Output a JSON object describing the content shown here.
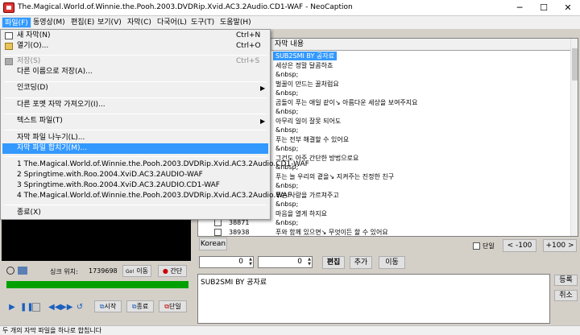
{
  "window": {
    "title": "The.Magical.World.of.Winnie.the.Pooh.2003.DVDRip.Xvid.AC3.2Audio.CD1-WAF - NeoCaption"
  },
  "menubar": [
    "파일(F)",
    "동영상(M)",
    "편집(E)",
    "보기(V)",
    "자막(C)",
    "다국어(L)",
    "도구(T)",
    "도움말(H)"
  ],
  "file_menu": {
    "new": {
      "label": "새 자막(N)",
      "shortcut": "Ctrl+N"
    },
    "open": {
      "label": "열기(O)...",
      "shortcut": "Ctrl+O"
    },
    "save": {
      "label": "저장(S)",
      "shortcut": "Ctrl+S"
    },
    "save_as": {
      "label": "다른 이름으로 저장(A)..."
    },
    "encoding": {
      "label": "인코딩(D)"
    },
    "import": {
      "label": "다른 포멧 자막 가져오기(I)..."
    },
    "text_file": {
      "label": "텍스트 파일(T)"
    },
    "split": {
      "label": "자막 파일 나누기(L)..."
    },
    "merge": {
      "label": "자막 파일 합치기(M)..."
    },
    "recent": [
      "1 The.Magical.World.of.Winnie.the.Pooh.2003.DVDRip.Xvid.AC3.2Audio.CD1-WAF",
      "2 Springtime.with.Roo.2004.XviD.AC3.2AUDIO-WAF",
      "3 Springtime.with.Roo.2004.XviD.AC3.2AUDIO.CD1-WAF",
      "4 The.Magical.World.of.Winnie.the.Pooh.2003.DVDRip.Xvid.AC3.2Audio.WAF"
    ],
    "exit": {
      "label": "종료(X)"
    }
  },
  "list": {
    "header_text": "자막 내용",
    "rows": [
      {
        "time": "",
        "text": "SUB2SMI BY 공자료"
      },
      {
        "time": "",
        "text": "세상은 정말 달콤하죠"
      },
      {
        "time": "",
        "text": "&nbsp;"
      },
      {
        "time": "",
        "text": "벌꿀이 만드는 꿀처럼요"
      },
      {
        "time": "",
        "text": "&nbsp;"
      },
      {
        "time": "",
        "text": "곰돌이 푸는 애일 같이↘ 아름다운 세상을 보여주지요"
      },
      {
        "time": "",
        "text": "&nbsp;"
      },
      {
        "time": "",
        "text": "아무리 일이 잘못 되어도"
      },
      {
        "time": "",
        "text": "&nbsp;"
      },
      {
        "time": "",
        "text": "푸는 전부 해결할 수 있어요"
      },
      {
        "time": "",
        "text": "&nbsp;"
      },
      {
        "time": "",
        "text": "그건도 아주 간단한 방법으로요"
      },
      {
        "time": "",
        "text": "&nbsp;"
      },
      {
        "time": "",
        "text": "푸는 늘 우리의 곁을↘ 지켜주는 진정한 친구"
      },
      {
        "time": "",
        "text": "&nbsp;"
      },
      {
        "time": "",
        "text": "푸는 사랑을 가르쳐주고"
      },
      {
        "time": "",
        "text": "&nbsp;"
      },
      {
        "time": "",
        "text": "마음을 열게 하지요"
      },
      {
        "time": "38871",
        "text": "&nbsp;"
      },
      {
        "time": "38938",
        "text": "푸와 함께 있으면↘ 무엇이든 할 수 있어요"
      }
    ]
  },
  "controls": {
    "lang_button": "Korean",
    "single_checkbox": "단일",
    "minus100": "< -100",
    "plus100": "+100 >",
    "spin1_value": "0",
    "spin2_value": "0",
    "edit_button": "편집",
    "add_button": "추가",
    "move_button": "이동",
    "register_button": "등록",
    "cancel_button": "취소",
    "edit_text": "SUB2SMI BY 공자료"
  },
  "player": {
    "sync_label": "싱크 위치:",
    "sync_value": "1739698",
    "move_label": "이동",
    "break_label": "간단",
    "start_label": "시작",
    "end_label": "종료",
    "single_label": "단일"
  },
  "statusbar": {
    "text": "두 개의 자막 파일을 하나로 합칩니다"
  }
}
